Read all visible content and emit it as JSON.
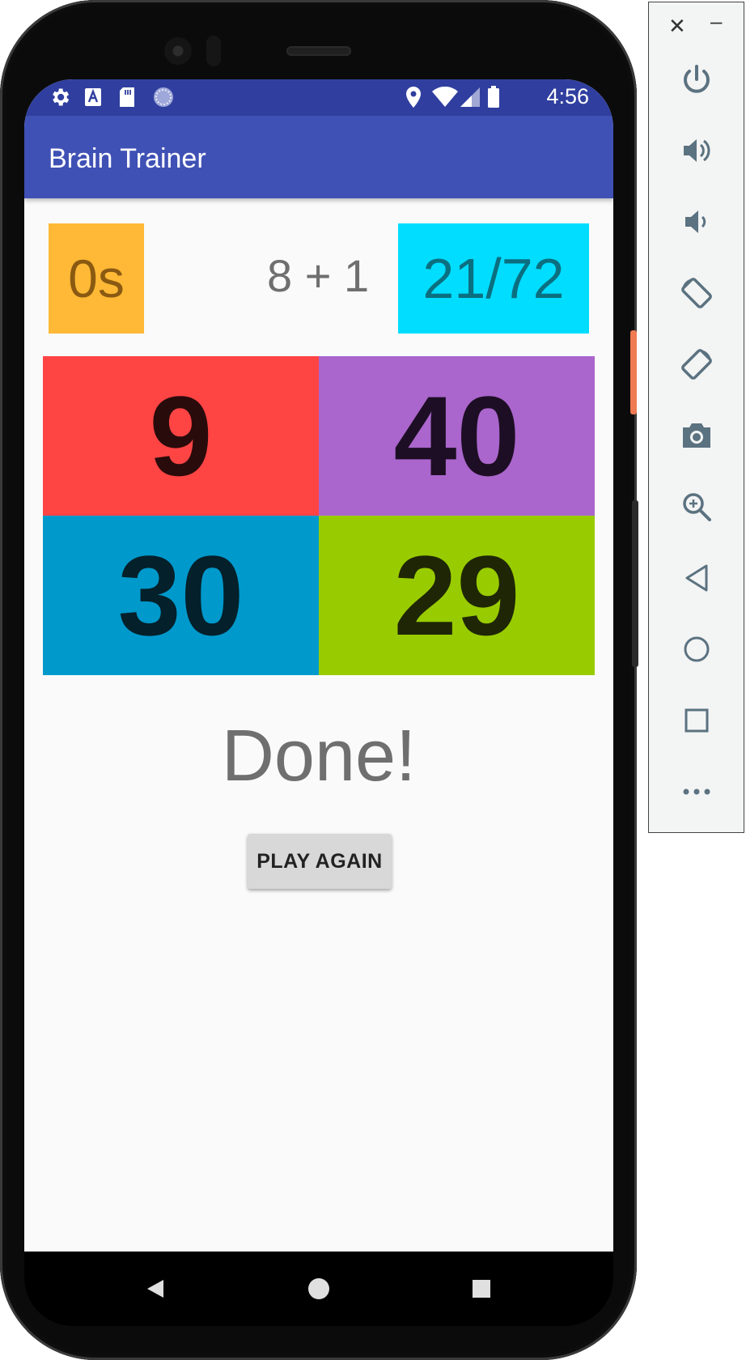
{
  "status_bar": {
    "time": "4:56",
    "left_icons": [
      "settings-icon",
      "a-notification-icon",
      "sd-card-icon",
      "sync-icon"
    ],
    "right_icons": [
      "location-icon",
      "wifi-icon",
      "signal-icon",
      "battery-icon"
    ]
  },
  "app_bar": {
    "title": "Brain Trainer"
  },
  "game": {
    "timer": "0s",
    "question": "8 + 1",
    "score": "21/72",
    "answers": [
      "9",
      "40",
      "30",
      "29"
    ],
    "result": "Done!",
    "play_again_label": "PLAY AGAIN"
  },
  "colors": {
    "primary_dark": "#303f9f",
    "primary": "#3f51b5",
    "timer_bg": "#ffb936",
    "score_bg": "#00ddff",
    "answer_0": "#ff4444",
    "answer_1": "#aa66cc",
    "answer_2": "#0099cc",
    "answer_3": "#99cc00"
  },
  "nav_bar": {
    "buttons": [
      "back-icon",
      "home-icon",
      "recents-icon"
    ]
  },
  "emulator_toolbar": {
    "buttons": [
      "close-icon",
      "minimize-icon",
      "power-icon",
      "volume-up-icon",
      "volume-down-icon",
      "rotate-left-icon",
      "rotate-right-icon",
      "screenshot-icon",
      "zoom-icon",
      "back-icon",
      "home-icon",
      "overview-icon",
      "more-icon"
    ]
  }
}
